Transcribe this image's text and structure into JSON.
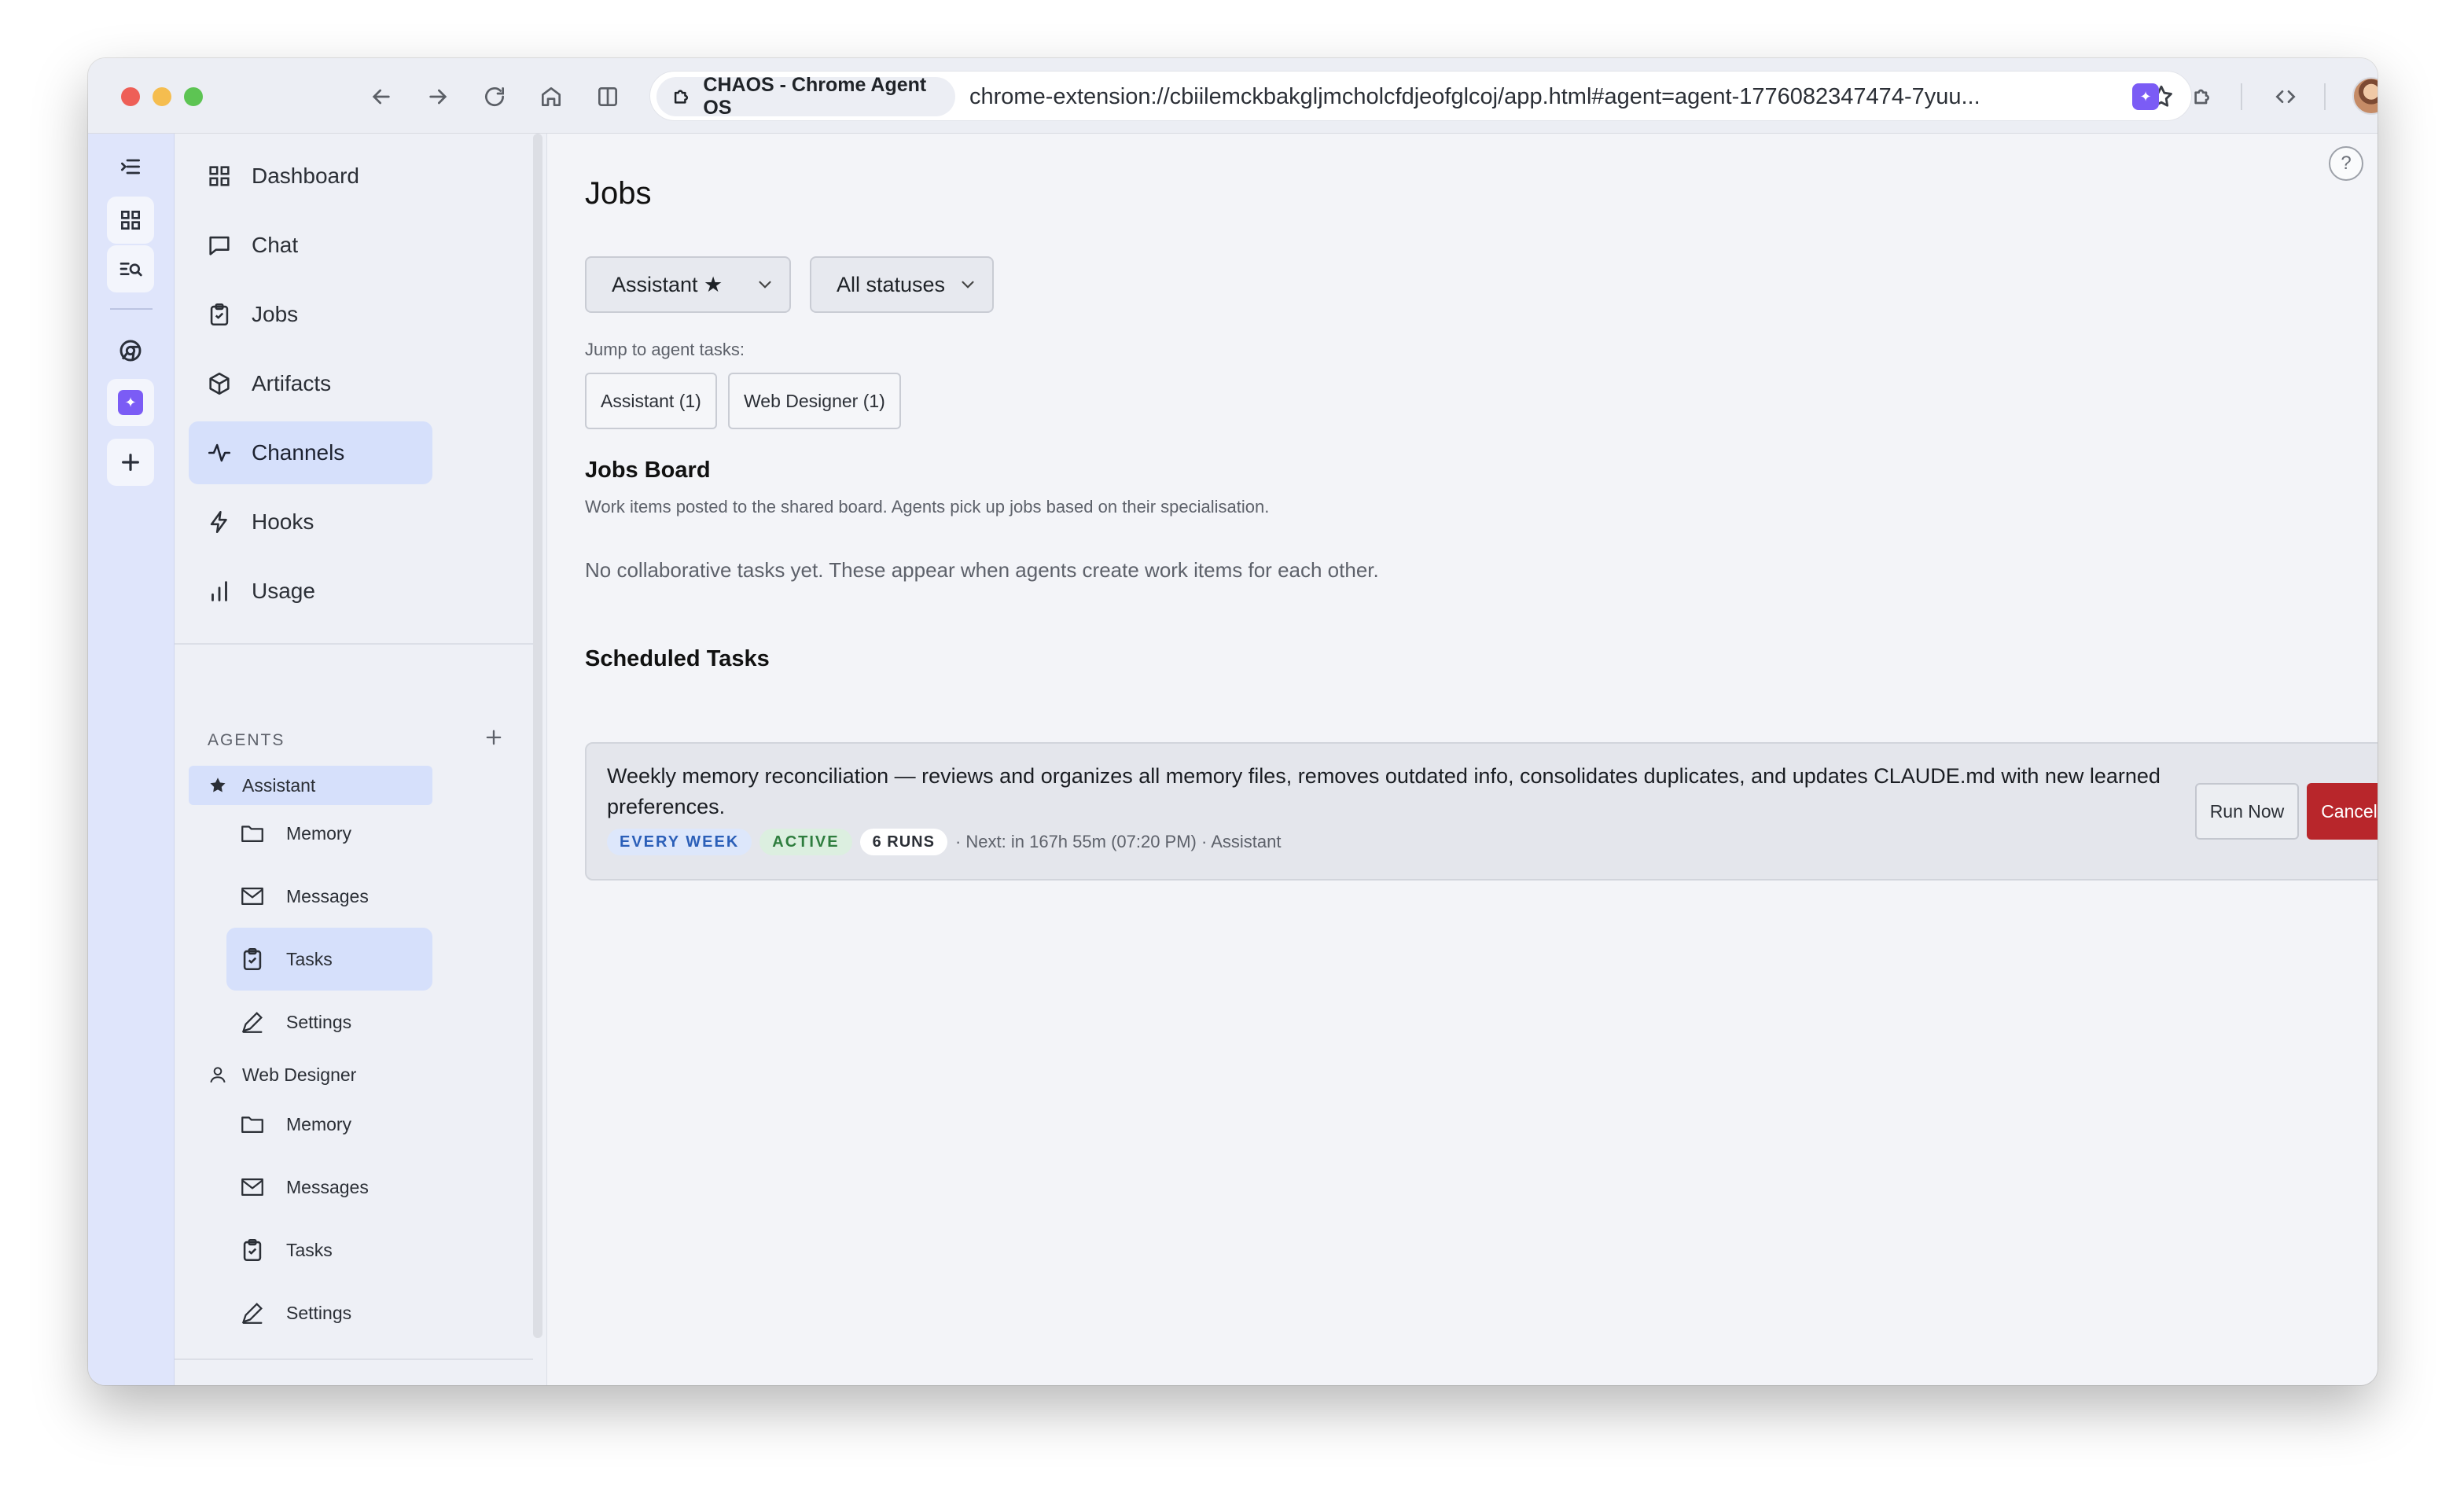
{
  "browser": {
    "tab_title": "CHAOS - Chrome Agent OS",
    "url": "chrome-extension://cbiilemckbakgljmcholcfdjeofglcoj/app.html#agent=agent-1776082347474-7yuu..."
  },
  "rail": {
    "items": [
      "menu-collapse-icon",
      "grid-icon",
      "search-list-icon",
      "chrome-icon",
      "extension-app-icon",
      "plus-icon"
    ]
  },
  "sidebar": {
    "nav": [
      {
        "label": "Dashboard",
        "icon": "grid-icon"
      },
      {
        "label": "Chat",
        "icon": "chat-icon"
      },
      {
        "label": "Jobs",
        "icon": "clipboard-check-icon"
      },
      {
        "label": "Artifacts",
        "icon": "box-icon"
      },
      {
        "label": "Channels",
        "icon": "activity-icon",
        "active": true
      },
      {
        "label": "Hooks",
        "icon": "bolt-icon"
      },
      {
        "label": "Usage",
        "icon": "bar-chart-icon"
      }
    ],
    "agents_heading": "AGENTS",
    "agents": [
      {
        "name": "Assistant",
        "icon": "star-icon",
        "active": true,
        "items": [
          {
            "label": "Memory",
            "icon": "folder-icon"
          },
          {
            "label": "Messages",
            "icon": "mail-icon"
          },
          {
            "label": "Tasks",
            "icon": "clipboard-check-icon",
            "active": true
          },
          {
            "label": "Settings",
            "icon": "pen-icon"
          }
        ]
      },
      {
        "name": "Web Designer",
        "icon": "user-icon",
        "items": [
          {
            "label": "Memory",
            "icon": "folder-icon"
          },
          {
            "label": "Messages",
            "icon": "mail-icon"
          },
          {
            "label": "Tasks",
            "icon": "clipboard-check-icon"
          },
          {
            "label": "Settings",
            "icon": "pen-icon"
          }
        ]
      }
    ],
    "settings_label": "Settings"
  },
  "main": {
    "title": "Jobs",
    "filters": {
      "agent": "Assistant ★",
      "status": "All statuses"
    },
    "jump_label": "Jump to agent tasks:",
    "jump_chips": [
      "Assistant (1)",
      "Web Designer (1)"
    ],
    "jobs_board": {
      "title": "Jobs Board",
      "description": "Work items posted to the shared board. Agents pick up jobs based on their specialisation.",
      "empty": "No collaborative tasks yet. These appear when agents create work items for each other."
    },
    "scheduled": {
      "title": "Scheduled Tasks",
      "tasks": [
        {
          "description": "Weekly memory reconciliation — reviews and organizes all memory files, removes outdated info, consolidates duplicates, and updates CLAUDE.md with new learned preferences.",
          "frequency": "EVERY WEEK",
          "status": "ACTIVE",
          "runs": "6 RUNS",
          "next": "· Next: in 167h 55m (07:20 PM) · Assistant",
          "run_label": "Run Now",
          "cancel_label": "Cancel"
        }
      ]
    }
  },
  "colors": {
    "accent": "#d6e0fb",
    "rail": "#dfe5fb",
    "cancel": "#b8262b",
    "badge_blue": "#2b5fb8",
    "badge_green": "#2e7d3e"
  }
}
